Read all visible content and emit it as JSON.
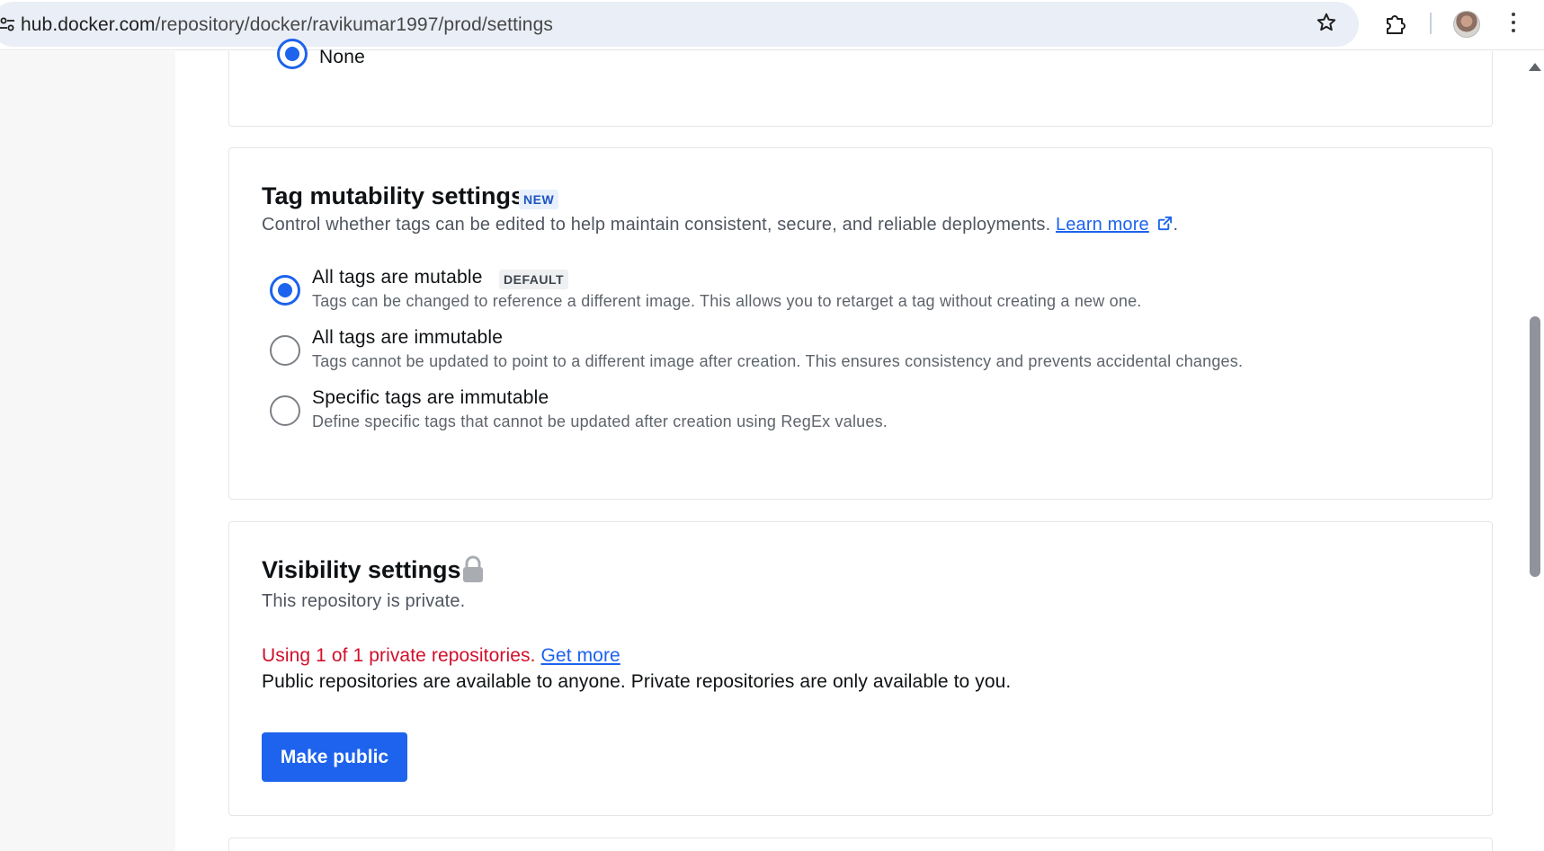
{
  "browser": {
    "url_host": "hub.docker.com",
    "url_path": "/repository/docker/ravikumar1997/prod/settings",
    "icons": [
      "site-info-icon",
      "bookmark-star-icon",
      "extensions-puzzle-icon",
      "profile-avatar",
      "more-vert-icon"
    ]
  },
  "previous_section": {
    "visible_option": "None",
    "checked": true
  },
  "tag_mutability": {
    "title": "Tag mutability settings",
    "badge": "NEW",
    "description": "Control whether tags can be edited to help maintain consistent, secure, and reliable deployments.",
    "learn_more": "Learn more",
    "trailing_period": ".",
    "selected": "All tags are mutable",
    "options": [
      {
        "label": "All tags are mutable",
        "badge": "DEFAULT",
        "description": "Tags can be changed to reference a different image. This allows you to retarget a tag without creating a new one.",
        "checked": true
      },
      {
        "label": "All tags are immutable",
        "description": "Tags cannot be updated to point to a different image after creation. This ensures consistency and prevents accidental changes.",
        "checked": false
      },
      {
        "label": "Specific tags are immutable",
        "description": "Define specific tags that cannot be updated after creation using RegEx values.",
        "checked": false
      }
    ]
  },
  "visibility": {
    "title": "Visibility settings",
    "title_icon": "lock-icon",
    "status": "This repository is private.",
    "usage_warning": "Using 1 of 1 private repositories.",
    "get_more": "Get more",
    "info": "Public repositories are available to anyone. Private repositories are only available to you.",
    "button_label": "Make public"
  },
  "colors": {
    "accent": "#1d63ed",
    "warning": "#d0102b",
    "badge_new_bg": "#e8f0fd"
  }
}
